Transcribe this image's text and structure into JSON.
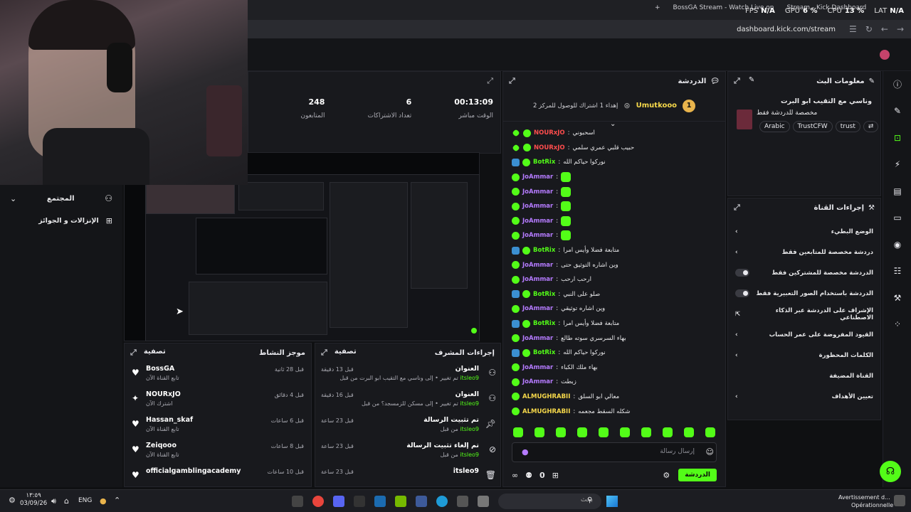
{
  "browser": {
    "tabs": [
      "BossGA Stream - Watch Live on",
      "Stream - Kick Dashboard"
    ],
    "url": "dashboard.kick.com/stream",
    "perf": [
      {
        "label": "FPS",
        "value": "N/A"
      },
      {
        "label": "GPU",
        "value": "6 %"
      },
      {
        "label": "CPU",
        "value": "13 %"
      },
      {
        "label": "LAT",
        "value": "N/A"
      }
    ]
  },
  "sidebar": {
    "section": "المجتمع",
    "items": [
      "الإنزالات و الجوائز"
    ]
  },
  "stats": {
    "items": [
      {
        "value": "00:13:09",
        "label": "الوقت مباشر"
      },
      {
        "value": "6",
        "label": "تعداد الاشتراكات"
      },
      {
        "value": "248",
        "label": "المتابعون"
      }
    ]
  },
  "feed": {
    "title": "موجز النشاط",
    "filter": "تصفية",
    "items": [
      {
        "name": "BossGA",
        "sub": "تابع القناة الآن",
        "time": "قبل 28 ثانية",
        "icon": "heart-icon"
      },
      {
        "name": "NOURxJO",
        "sub": "اشترك الآن",
        "time": "قبل 4 دقائق",
        "icon": "sparkle-icon"
      },
      {
        "name": "Hassan_skaf",
        "sub": "تابع القناة الآن",
        "time": "قبل 6 ساعات",
        "icon": "heart-icon"
      },
      {
        "name": "Zeiqooo",
        "sub": "تابع القناة الآن",
        "time": "قبل 8 ساعات",
        "icon": "heart-icon"
      },
      {
        "name": "officialgamblingacademy",
        "sub": "",
        "time": "قبل 10 ساعات",
        "icon": "heart-icon"
      }
    ]
  },
  "mod": {
    "title": "إجراءات المشرف",
    "filter": "تصفية",
    "items": [
      {
        "title": "العنوان",
        "actor": "itsleo9",
        "detail": "تم تغيير • إلى وناسي مع التقيب ابو البرت من قبل",
        "time": "قبل 13 دقيقة",
        "icon": "title-icon"
      },
      {
        "title": "العنوان",
        "actor": "itsleo9",
        "detail": "تم تغيير • إلى مسكن للزمسجد؟ من قبل",
        "time": "قبل 16 دقيقة",
        "icon": "title-icon"
      },
      {
        "title": "تم تثبيت الرسالة",
        "actor": "itsleo9",
        "detail": "من قبل",
        "time": "قبل 23 ساعة",
        "icon": "pin-icon"
      },
      {
        "title": "تم إلغاء تثبيت الرسالة",
        "actor": "itsleo9",
        "detail": "من قبل",
        "time": "قبل 23 ساعة",
        "icon": "unpin-icon"
      },
      {
        "title": "itsleo9",
        "actor": "",
        "detail": "",
        "time": "قبل 23 ساعة",
        "icon": "trash-icon"
      }
    ]
  },
  "chat": {
    "title": "الدردشة",
    "pinned": {
      "rank": "1",
      "name": "Umutkooo",
      "note": "إهداء 1 اشتراك للوصول للمركز 2"
    },
    "messages": [
      {
        "user": "NOURxJO",
        "color": "red",
        "text": "اسحبوني"
      },
      {
        "user": "NOURxJO",
        "color": "red",
        "text": "حبيب قلبي عمري سلمي"
      },
      {
        "user": "BotRix",
        "color": "green",
        "text": "نوركوا حياكم الله"
      },
      {
        "user": "JoAmmar",
        "color": "purple",
        "text": ""
      },
      {
        "user": "JoAmmar",
        "color": "purple",
        "text": ""
      },
      {
        "user": "JoAmmar",
        "color": "purple",
        "text": ""
      },
      {
        "user": "JoAmmar",
        "color": "purple",
        "text": ""
      },
      {
        "user": "JoAmmar",
        "color": "purple",
        "text": ""
      },
      {
        "user": "BotRix",
        "color": "green",
        "text": "متابعة فضلا وأيس امرا"
      },
      {
        "user": "JoAmmar",
        "color": "purple",
        "text": "وين اشاره التوثيق حتى"
      },
      {
        "user": "JoAmmar",
        "color": "purple",
        "text": "ارحب ارحب"
      },
      {
        "user": "BotRix",
        "color": "green",
        "text": "صلو على النبي"
      },
      {
        "user": "JoAmmar",
        "color": "purple",
        "text": "وين اشاره توثيقي"
      },
      {
        "user": "BotRix",
        "color": "green",
        "text": "متابعة فضلا وأيس امرا"
      },
      {
        "user": "JoAmmar",
        "color": "purple",
        "text": "بهاء السرسري سوته طالع"
      },
      {
        "user": "BotRix",
        "color": "green",
        "text": "نوركوا حياكم الله"
      },
      {
        "user": "JoAmmar",
        "color": "purple",
        "text": "بهاء ملك الكباء"
      },
      {
        "user": "JoAmmar",
        "color": "purple",
        "text": "زبطت"
      },
      {
        "user": "ALMUGHRABII",
        "color": "yellow",
        "text": "معالي ابو السلق"
      },
      {
        "user": "ALMUGHRABII",
        "color": "yellow",
        "text": "شكله السقط مجعمه"
      }
    ],
    "placeholder": "إرسال رسالة",
    "send": "الدردشة",
    "counter": "0"
  },
  "info": {
    "title": "معلومات البث",
    "stream_title": "وناسي مع التقيب ابو البرت",
    "category": "مخصصة للدردشة فقط",
    "tags": [
      "Arabic",
      "TrustCFW",
      "trust"
    ]
  },
  "actions": {
    "title": "إجراءات القناة",
    "items": [
      {
        "label": "الوضع البطيء",
        "kind": "arrow"
      },
      {
        "label": "دردشة مخصصة للمتابعين فقط",
        "kind": "arrow"
      },
      {
        "label": "الدردشة مخصصة للمشتركين فقط",
        "kind": "toggle"
      },
      {
        "label": "الدردشة باستخدام الصور التعبيرية فقط",
        "kind": "toggle"
      },
      {
        "label": "الإشراف على الدردشة عبر الذكاء الاصطناعي",
        "kind": "external"
      },
      {
        "label": "القيود المفروضة على عمر الحساب",
        "kind": "arrow"
      },
      {
        "label": "الكلمات المحظورة",
        "kind": "arrow"
      },
      {
        "label": "القناة المضيفة",
        "kind": "none"
      },
      {
        "label": "تعيين الأهداف",
        "kind": "arrow"
      }
    ]
  },
  "taskbar": {
    "time": "١٣:٥٩",
    "date": "03/09/26",
    "lang": "ENG",
    "search": "بحث",
    "notice_title": "Avertissement d...",
    "notice_sub": "Opérationnelle"
  },
  "colors": {
    "accent": "#53fc18",
    "panel": "#18191d",
    "bg": "#0f1012"
  }
}
